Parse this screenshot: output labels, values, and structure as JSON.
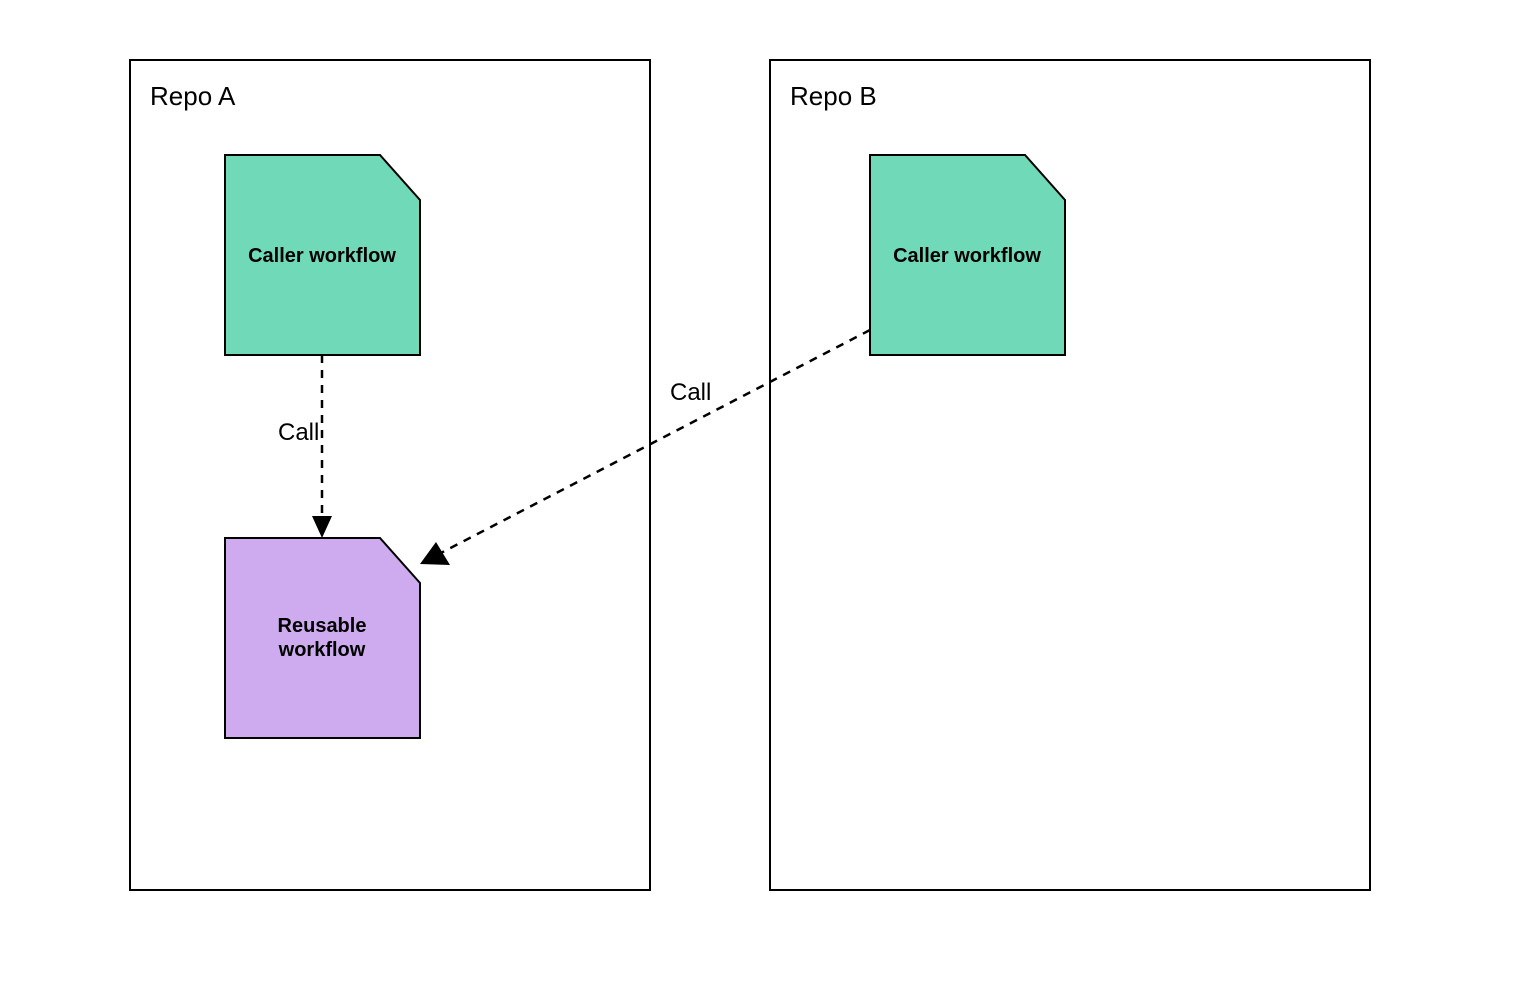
{
  "diagram": {
    "repos": {
      "a": {
        "label": "Repo A"
      },
      "b": {
        "label": "Repo B"
      }
    },
    "nodes": {
      "caller_a": {
        "label": "Caller workflow",
        "type": "caller",
        "repo": "a"
      },
      "reusable": {
        "label1": "Reusable",
        "label2": "workflow",
        "type": "reusable",
        "repo": "a"
      },
      "caller_b": {
        "label": "Caller workflow",
        "type": "caller",
        "repo": "b"
      }
    },
    "edges": {
      "a_internal": {
        "from": "caller_a",
        "to": "reusable",
        "label": "Call"
      },
      "b_to_a": {
        "from": "caller_b",
        "to": "reusable",
        "label": "Call"
      }
    },
    "colors": {
      "caller_fill": "#6fd9b8",
      "reusable_fill": "#ceabef",
      "stroke": "#000000",
      "background": "#ffffff"
    }
  }
}
